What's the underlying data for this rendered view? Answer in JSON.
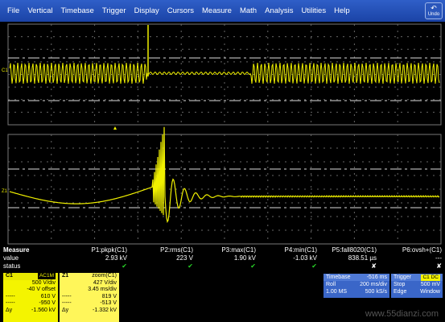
{
  "menu": [
    "File",
    "Vertical",
    "Timebase",
    "Trigger",
    "Display",
    "Cursors",
    "Measure",
    "Math",
    "Analysis",
    "Utilities",
    "Help"
  ],
  "undo_label": "Undo",
  "channels": {
    "top": "C1",
    "bottom": "Z1"
  },
  "measure": {
    "row_labels": {
      "header": "Measure",
      "value": "value",
      "status": "status"
    },
    "params": [
      {
        "name": "P1:pkpk(C1)",
        "value": "2.93 kV",
        "status": "ok"
      },
      {
        "name": "P2:rms(C1)",
        "value": "223 V",
        "status": "ok"
      },
      {
        "name": "P3:max(C1)",
        "value": "1.90 kV",
        "status": "ok"
      },
      {
        "name": "P4:min(C1)",
        "value": "-1.03 kV",
        "status": "ok"
      },
      {
        "name": "P5:fall8020(C1)",
        "value": "838.51 µs",
        "status": "bad"
      },
      {
        "name": "P6:ovsh+(C1)",
        "value": "---",
        "status": "bad"
      }
    ]
  },
  "c1_panel": {
    "name": "C1",
    "coupling": "AC1M",
    "rows": [
      {
        "l": "",
        "r": "500 V/div"
      },
      {
        "l": "",
        "r": "-40 V offset"
      },
      {
        "l": "-----",
        "r": "610 V"
      },
      {
        "l": "-----",
        "r": "-950 V"
      },
      {
        "l": "Δy",
        "r": "-1.560 kV"
      }
    ]
  },
  "z1_panel": {
    "name": "Z1",
    "func": "zoom(C1)",
    "rows": [
      {
        "l": "",
        "r": "427 V/div"
      },
      {
        "l": "",
        "r": "3.45 ms/div"
      },
      {
        "l": "-----",
        "r": "819 V"
      },
      {
        "l": "-----",
        "r": "-513 V"
      },
      {
        "l": "Δy",
        "r": "-1.332 kV"
      }
    ]
  },
  "timebase": {
    "label": "Timebase",
    "delay": "-516 ms",
    "mode": "Roll",
    "div": "200 ms/div",
    "mem": "1.00 MS",
    "rate": "500 kS/s"
  },
  "trigger": {
    "label": "Trigger",
    "source": "C1 DC",
    "mode": "Stop",
    "level": "500 mV",
    "type": "Edge",
    "slope": "Window"
  },
  "watermark": "www.55dianzi.com",
  "colors": {
    "trace": "#f0f000",
    "menu": "#2f5fc8",
    "ok": "#28d228",
    "panel": "#f4f400",
    "box": "#3a66c8"
  }
}
